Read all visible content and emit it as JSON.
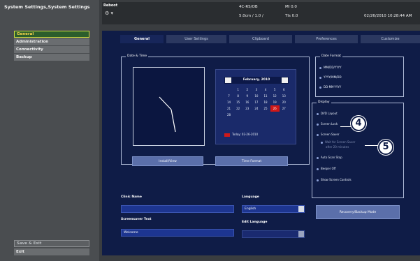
{
  "sidebar": {
    "title": "System Settings,System Settings",
    "items": [
      {
        "label": "General",
        "active": true
      },
      {
        "label": "Administration",
        "active": false
      },
      {
        "label": "Connectivity",
        "active": false
      },
      {
        "label": "Backup",
        "active": false
      }
    ],
    "bottom": {
      "save_exit": "Save & Exit",
      "exit": "Exit"
    }
  },
  "header": {
    "name": "Reboot",
    "icon": "probe-icon",
    "freq": "4C-RS/OB",
    "depth": "5.0cm / 1.0 /",
    "mi": "MI 0.0",
    "tis": "TIs 0.0",
    "datetime": "02/26/2010  10:28:44 AM"
  },
  "tabs": [
    "General",
    "User Settings",
    "Clipboard",
    "Preferences",
    "Customize"
  ],
  "date_time": {
    "label": "Date & Time",
    "calendar": {
      "month": "February, 2010",
      "weeks": [
        [
          "",
          "1",
          "2",
          "3",
          "4",
          "5",
          "6"
        ],
        [
          "7",
          "8",
          "9",
          "10",
          "11",
          "12",
          "13"
        ],
        [
          "14",
          "15",
          "16",
          "17",
          "18",
          "19",
          "20"
        ],
        [
          "21",
          "22",
          "23",
          "24",
          "25",
          "26",
          "27"
        ],
        [
          "28",
          "",
          "",
          "",
          "",
          "",
          ""
        ]
      ],
      "selected": "26",
      "today": "Today: 02-26-2010"
    },
    "install_button": "Install/View",
    "timezone_button": "Time Format"
  },
  "date_format": {
    "label": "Date Format",
    "options": [
      "MM/DD/YYYY",
      "YYYY/MM/DD",
      "DD-MM-YYYY"
    ]
  },
  "display": {
    "label": "Display",
    "options": [
      {
        "label": "DVD Layout",
        "dim": false
      },
      {
        "label": "Screen Lock",
        "dim": false
      },
      {
        "label": "Screen Saver",
        "dim": false
      },
      {
        "label": "Wait for Screen Saver",
        "dim": true
      },
      {
        "label": "after 20 minutes",
        "dim": true
      },
      {
        "label": "Auto Scan Stop",
        "dim": false
      },
      {
        "label": "Beeper Off",
        "dim": false
      },
      {
        "label": "Show Screen Controls",
        "dim": false
      }
    ]
  },
  "clinic": {
    "label": "Clinic Name",
    "value": ""
  },
  "language": {
    "label": "Language",
    "value": "English"
  },
  "screensaver": {
    "label": "Screensaver Text",
    "value": "Welcome"
  },
  "edit_language": {
    "label": "Edit Language",
    "value": ""
  },
  "recovery_button": "Recovery/Backup Mode",
  "callouts": [
    "4",
    "5"
  ]
}
